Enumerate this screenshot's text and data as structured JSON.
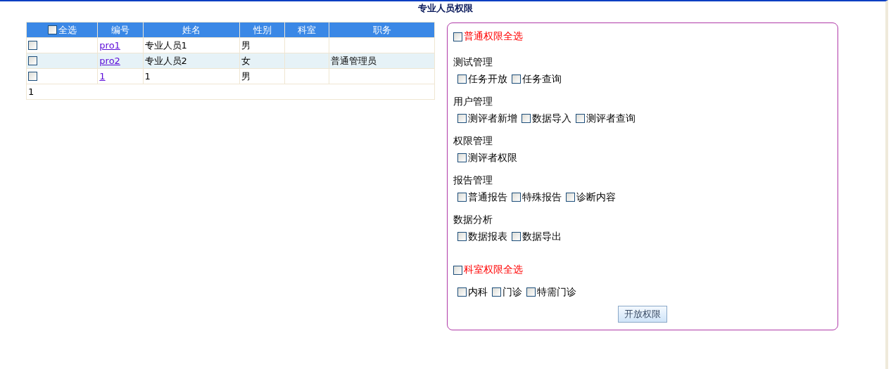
{
  "title": "专业人员权限",
  "table": {
    "select_all": {
      "label": "全选",
      "checked": false
    },
    "columns": [
      "编号",
      "姓名",
      "性别",
      "科室",
      "职务"
    ],
    "rows": [
      {
        "checked": false,
        "selected": false,
        "id": "pro1",
        "name": "专业人员1",
        "gender": "男",
        "dept": "",
        "position": ""
      },
      {
        "checked": false,
        "selected": true,
        "id": "pro2",
        "name": "专业人员2",
        "gender": "女",
        "dept": "",
        "position": "普通管理员"
      },
      {
        "checked": false,
        "selected": false,
        "id": "1",
        "name": "1",
        "gender": "男",
        "dept": "",
        "position": ""
      }
    ],
    "pager": "1"
  },
  "permissions": {
    "general_select_all": {
      "label": "普通权限全选",
      "checked": false
    },
    "groups": [
      {
        "title": "测试管理",
        "items": [
          {
            "label": "任务开放",
            "checked": false
          },
          {
            "label": "任务查询",
            "checked": false
          }
        ]
      },
      {
        "title": "用户管理",
        "items": [
          {
            "label": "测评者新增",
            "checked": false
          },
          {
            "label": "数据导入",
            "checked": false
          },
          {
            "label": "测评者查询",
            "checked": false
          }
        ]
      },
      {
        "title": "权限管理",
        "items": [
          {
            "label": "测评者权限",
            "checked": false
          }
        ]
      },
      {
        "title": "报告管理",
        "items": [
          {
            "label": "普通报告",
            "checked": false
          },
          {
            "label": "特殊报告",
            "checked": false
          },
          {
            "label": "诊断内容",
            "checked": false
          }
        ]
      },
      {
        "title": "数据分析",
        "items": [
          {
            "label": "数据报表",
            "checked": false
          },
          {
            "label": "数据导出",
            "checked": false
          }
        ]
      }
    ],
    "dept_select_all": {
      "label": "科室权限全选",
      "checked": false
    },
    "depts": [
      {
        "label": "内科",
        "checked": false
      },
      {
        "label": "门诊",
        "checked": false
      },
      {
        "label": "特需门诊",
        "checked": false
      }
    ],
    "button": "开放权限"
  }
}
